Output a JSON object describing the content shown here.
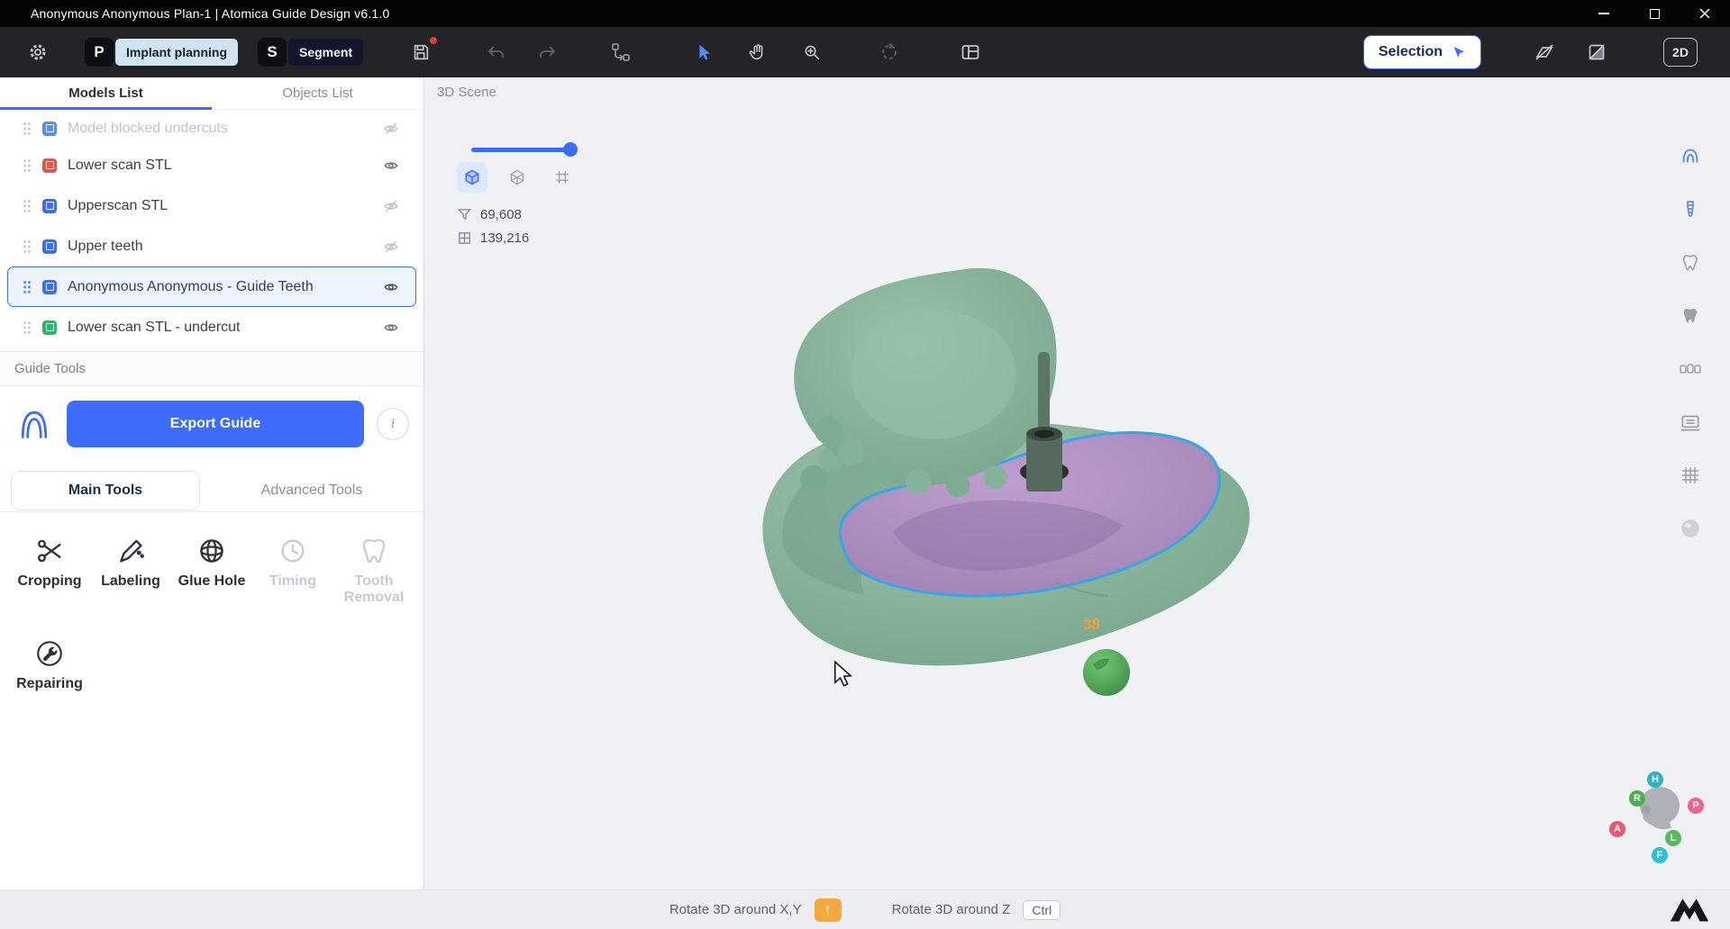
{
  "window": {
    "title": "Anonymous Anonymous Plan-1 | Atomica Guide Design v6.1.0"
  },
  "toolbar": {
    "modules": [
      {
        "logo_text": "P",
        "label": "Implant planning"
      },
      {
        "logo_text": "S",
        "label": "Segment"
      }
    ],
    "selection_button_label": "Selection",
    "view_2d_label": "2D"
  },
  "sidebar": {
    "tabs": [
      {
        "label": "Models List",
        "active": true
      },
      {
        "label": "Objects List",
        "active": false
      }
    ],
    "models": [
      {
        "label": "Model blocked undercuts",
        "color": "#5b8cf0",
        "visible": false,
        "disabled": true
      },
      {
        "label": "Lower scan STL",
        "color": "#e2574c",
        "visible": true
      },
      {
        "label": "Upperscan STL",
        "color": "#3d6bfa",
        "visible": false
      },
      {
        "label": "Upper teeth",
        "color": "#3d6bfa",
        "visible": false
      },
      {
        "label": "Anonymous Anonymous - Guide Teeth",
        "color": "#3d6bfa",
        "visible": true,
        "selected": true
      },
      {
        "label": "Lower scan STL - undercut",
        "color": "#34b36b",
        "visible": true
      }
    ],
    "guide_tools_header": "Guide Tools",
    "export_button_label": "Export Guide",
    "info_button_label": "i",
    "tool_tabs": [
      {
        "label": "Main Tools",
        "active": true
      },
      {
        "label": "Advanced Tools",
        "active": false
      }
    ],
    "tools": [
      {
        "label": "Cropping",
        "icon": "scissors-icon",
        "enabled": true
      },
      {
        "label": "Labeling",
        "icon": "pen-icon",
        "enabled": true
      },
      {
        "label": "Glue Hole",
        "icon": "sphere-icon",
        "enabled": true
      },
      {
        "label": "Timing",
        "icon": "clock-icon",
        "enabled": false
      },
      {
        "label": "Tooth Removal",
        "icon": "tooth-icon",
        "enabled": false
      },
      {
        "label": "Repairing",
        "icon": "wrench-icon",
        "enabled": true
      }
    ]
  },
  "scene": {
    "title": "3D Scene",
    "stats": [
      {
        "icon": "funnel-icon",
        "value": "69,608"
      },
      {
        "icon": "mesh-icon",
        "value": "139,216"
      }
    ],
    "tooth_number_label": "38",
    "orientation_badges": [
      {
        "label": "H",
        "color": "#2bb3c8"
      },
      {
        "label": "R",
        "color": "#4caf50"
      },
      {
        "label": "P",
        "color": "#f06292"
      },
      {
        "label": "A",
        "color": "#e45b72"
      },
      {
        "label": "L",
        "color": "#5cb85c"
      },
      {
        "label": "F",
        "color": "#29c2d1"
      }
    ]
  },
  "statusbar": {
    "rotate_xy_label": "Rotate 3D around X,Y",
    "shift_key_glyph": "↑",
    "rotate_z_label": "Rotate 3D around Z",
    "ctrl_key_label": "Ctrl"
  },
  "colors": {
    "accent_blue": "#3d6bfa",
    "model_teal": "#87b59c",
    "guide_purple": "#b08fc4",
    "guide_outline_blue": "#38a6e4",
    "anchor_green": "#4caf50",
    "tooth_label_orange": "#f0a23a"
  }
}
